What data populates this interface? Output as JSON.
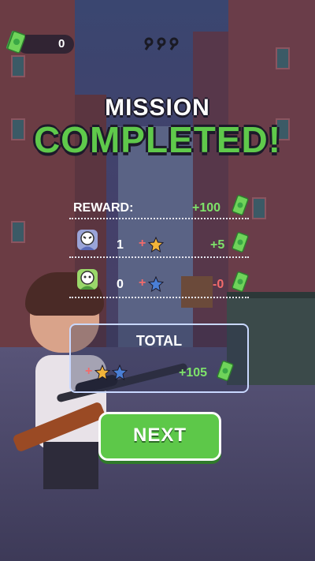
{
  "hud": {
    "cash_value": "0",
    "cash_icon": "cash-icon",
    "keys_icon": "keys-icon"
  },
  "mission": {
    "title_line1": "MISSION",
    "title_line2": "COMPLETED!"
  },
  "reward": {
    "label": "REWARD:",
    "amount": "+100"
  },
  "kills": [
    {
      "icon": "enemy-face-icon",
      "count": "1",
      "plus": "+",
      "star_icon": "gold-star-icon",
      "amount": "+5"
    },
    {
      "icon": "hostage-face-icon",
      "count": "0",
      "plus": "+",
      "star_icon": "blue-star-icon",
      "amount": "-0"
    }
  ],
  "total": {
    "label": "TOTAL",
    "plus": "+",
    "amount": "+105"
  },
  "next_button": {
    "label": "NEXT"
  },
  "colors": {
    "accent_green": "#5fc94b",
    "positive_text": "#7ee36a",
    "negative_text": "#f36b6b"
  }
}
